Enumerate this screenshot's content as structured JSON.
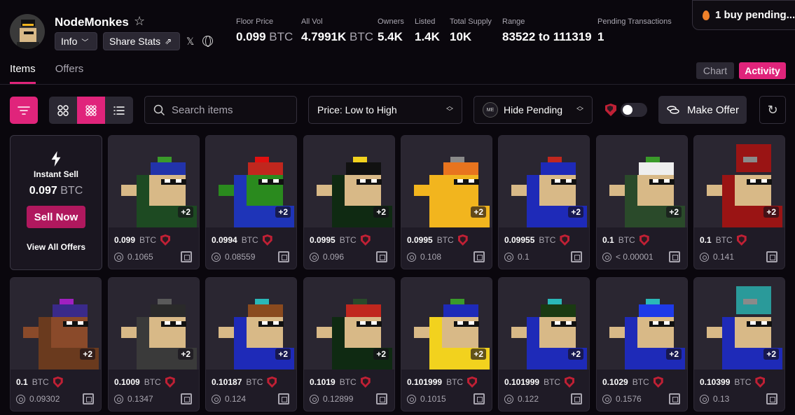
{
  "collection": {
    "name": "NodeMonkes",
    "info_label": "Info",
    "share_label": "Share Stats"
  },
  "stats": [
    {
      "label": "Floor Price",
      "value": "0.099",
      "unit": "BTC"
    },
    {
      "label": "All Vol",
      "value": "4.7991K",
      "unit": "BTC"
    },
    {
      "label": "Owners",
      "value": "5.4K",
      "unit": ""
    },
    {
      "label": "Listed",
      "value": "1.4K",
      "unit": ""
    },
    {
      "label": "Total Supply",
      "value": "10K",
      "unit": ""
    },
    {
      "label": "Range",
      "value": "83522 to 111319",
      "unit": ""
    },
    {
      "label": "Pending Transactions",
      "value": "1",
      "unit": ""
    }
  ],
  "pending_banner": "1 buy pending...",
  "tabs": [
    "Items",
    "Offers"
  ],
  "view_toggle": {
    "chart": "Chart",
    "activity": "Activity"
  },
  "search": {
    "placeholder": "Search items"
  },
  "sort": {
    "selected": "Price: Low to High"
  },
  "pending_filter": {
    "selected": "Hide Pending",
    "badge": "ME"
  },
  "make_offer_label": "Make Offer",
  "instant_sell": {
    "title": "Instant Sell",
    "price": "0.097",
    "unit": "BTC",
    "button": "Sell Now",
    "view_all": "View All Offers"
  },
  "items": [
    {
      "price": "0.099",
      "unit": "BTC",
      "last": "0.1065",
      "plus": "+2",
      "bg": "#2a2631",
      "skin": "#d8b987",
      "cloth": "#1d4a22",
      "hat": "#2233aa",
      "accent": "#3a9a2a"
    },
    {
      "price": "0.0994",
      "unit": "BTC",
      "last": "0.08559",
      "plus": "+2",
      "bg": "#2a2631",
      "skin": "#2a8a1e",
      "cloth": "#1e34b8",
      "hat": "#c0271e",
      "accent": "#e01010"
    },
    {
      "price": "0.0995",
      "unit": "BTC",
      "last": "0.096",
      "plus": "+2",
      "bg": "#2a2631",
      "skin": "#d8b987",
      "cloth": "#0f2a12",
      "hat": "#111111",
      "accent": "#f2d21e"
    },
    {
      "price": "0.0995",
      "unit": "BTC",
      "last": "0.108",
      "plus": "+2",
      "bg": "#2a2631",
      "skin": "#f2b51e",
      "cloth": "#f2b51e",
      "hat": "#e8741e",
      "accent": "#8a8a8a"
    },
    {
      "price": "0.09955",
      "unit": "BTC",
      "last": "0.1",
      "plus": "+2",
      "bg": "#2a2631",
      "skin": "#d8b987",
      "cloth": "#1e2ab8",
      "hat": "#1e2ab8",
      "accent": "#c0271e"
    },
    {
      "price": "0.1",
      "unit": "BTC",
      "last": "< 0.00001",
      "plus": "+2",
      "bg": "#2a2631",
      "skin": "#d8b987",
      "cloth": "#2a4a2a",
      "hat": "#eeeeee",
      "accent": "#3a9a2a"
    },
    {
      "price": "0.1",
      "unit": "BTC",
      "last": "0.141",
      "plus": "+2",
      "bg": "#2a2631",
      "skin": "#d8b987",
      "cloth": "#9a1414",
      "hat": "#9a1414",
      "accent": "#8a8a8a"
    },
    {
      "price": "0.1",
      "unit": "BTC",
      "last": "0.09302",
      "plus": "+2",
      "bg": "#2a2631",
      "skin": "#8a4a2a",
      "cloth": "#6a3a1e",
      "hat": "#3a2a8a",
      "accent": "#a020c0"
    },
    {
      "price": "0.1009",
      "unit": "BTC",
      "last": "0.1347",
      "plus": "+2",
      "bg": "#2a2631",
      "skin": "#d8b987",
      "cloth": "#3a3a3a",
      "hat": "#2a2a2a",
      "accent": "#5a5a5a"
    },
    {
      "price": "0.10187",
      "unit": "BTC",
      "last": "0.124",
      "plus": "+2",
      "bg": "#2a2631",
      "skin": "#d8b987",
      "cloth": "#1e2ab8",
      "hat": "#8a4a1e",
      "accent": "#2ab8b8"
    },
    {
      "price": "0.1019",
      "unit": "BTC",
      "last": "0.12899",
      "plus": "+2",
      "bg": "#2a2631",
      "skin": "#d8b987",
      "cloth": "#0f2a12",
      "hat": "#c0271e",
      "accent": "#2a4a2a"
    },
    {
      "price": "0.101999",
      "unit": "BTC",
      "last": "0.1015",
      "plus": "+2",
      "bg": "#2a2631",
      "skin": "#d8b987",
      "cloth": "#f2d21e",
      "hat": "#1e2ab8",
      "accent": "#3a9a2a"
    },
    {
      "price": "0.101999",
      "unit": "BTC",
      "last": "0.122",
      "plus": "+2",
      "bg": "#2a2631",
      "skin": "#d8b987",
      "cloth": "#1e2ab8",
      "hat": "#1a3a12",
      "accent": "#2ab8b8"
    },
    {
      "price": "0.1029",
      "unit": "BTC",
      "last": "0.1576",
      "plus": "+2",
      "bg": "#2a2631",
      "skin": "#d8b987",
      "cloth": "#1e2ab8",
      "hat": "#1e3ae8",
      "accent": "#2ab8b8"
    },
    {
      "price": "0.10399",
      "unit": "BTC",
      "last": "0.13",
      "plus": "+2",
      "bg": "#2a2631",
      "skin": "#d8b987",
      "cloth": "#1e2ab8",
      "hat": "#2a9a9a",
      "accent": "#8a8a8a"
    }
  ]
}
